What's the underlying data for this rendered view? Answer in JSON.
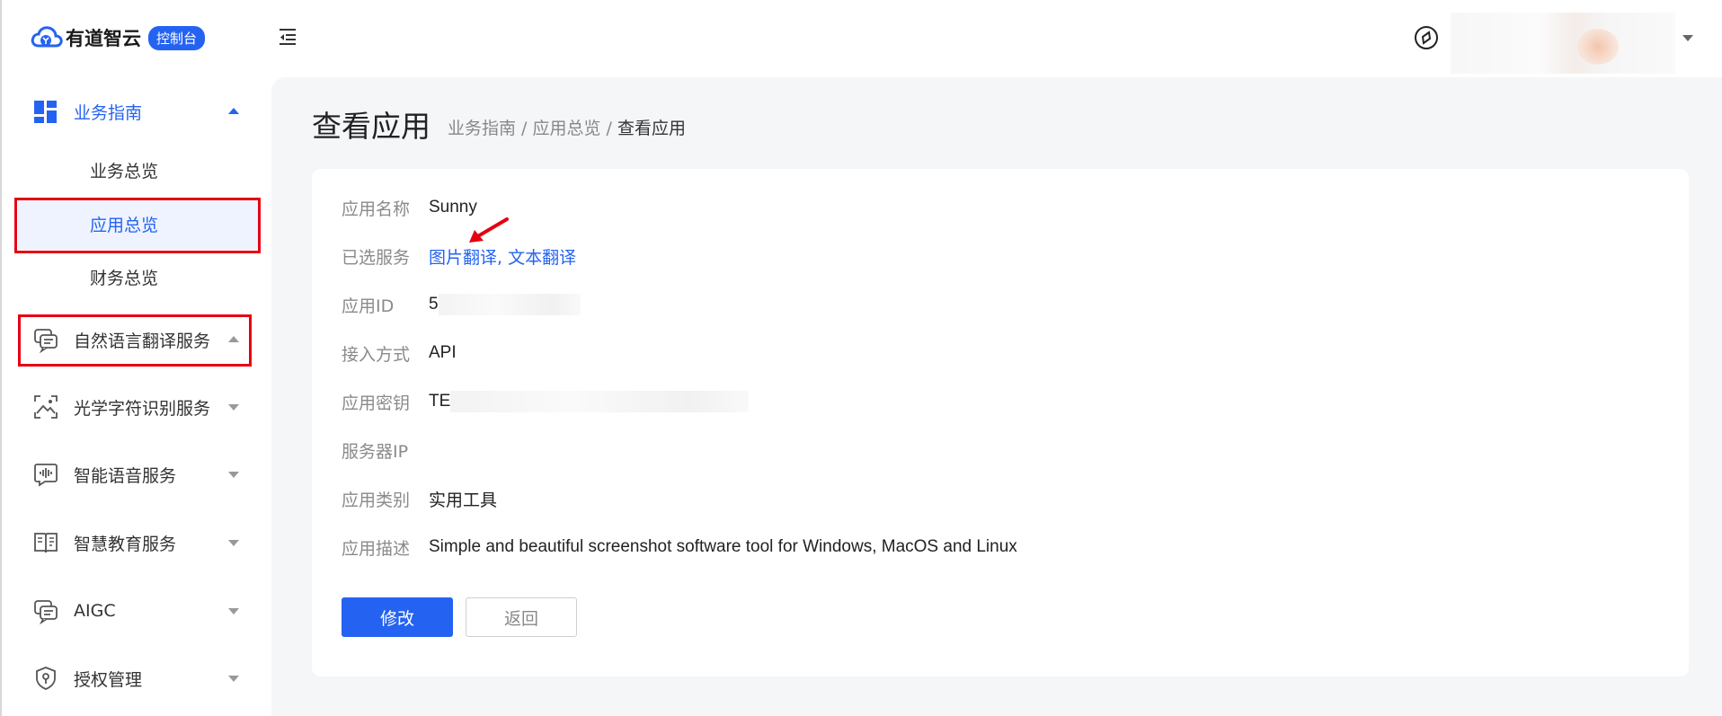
{
  "brand": {
    "name": "有道智云",
    "badge": "控制台",
    "accent_color": "#2463f2"
  },
  "sidebar": {
    "groups": [
      {
        "label": "业务指南",
        "icon": "dashboard-grid-icon",
        "expanded": true,
        "items": [
          {
            "label": "业务总览"
          },
          {
            "label": "应用总览",
            "selected": true
          },
          {
            "label": "财务总览"
          }
        ]
      },
      {
        "label": "自然语言翻译服务",
        "icon": "chat-translate-icon",
        "expanded": true
      },
      {
        "label": "光学字符识别服务",
        "icon": "scan-image-icon",
        "expanded": false
      },
      {
        "label": "智能语音服务",
        "icon": "voice-wave-icon",
        "expanded": false
      },
      {
        "label": "智慧教育服务",
        "icon": "education-book-icon",
        "expanded": false
      },
      {
        "label": "AIGC",
        "icon": "aigc-chat-icon",
        "expanded": false
      },
      {
        "label": "授权管理",
        "icon": "shield-key-icon",
        "expanded": false
      }
    ]
  },
  "page": {
    "title": "查看应用",
    "breadcrumb": {
      "parts": [
        "业务指南",
        "应用总览"
      ],
      "separator": " / ",
      "current": "查看应用"
    }
  },
  "details": {
    "name": {
      "label": "应用名称",
      "value": "Sunny"
    },
    "services": {
      "label": "已选服务",
      "value": "图片翻译, 文本翻译"
    },
    "app_id": {
      "label": "应用ID",
      "value": "5"
    },
    "access": {
      "label": "接入方式",
      "value": "API"
    },
    "secret": {
      "label": "应用密钥",
      "value": "TE"
    },
    "server_ip": {
      "label": "服务器IP",
      "value": ""
    },
    "category": {
      "label": "应用类别",
      "value": "实用工具"
    },
    "description": {
      "label": "应用描述",
      "value": "Simple and beautiful screenshot software tool for Windows, MacOS and Linux"
    }
  },
  "actions": {
    "edit": "修改",
    "back": "返回"
  }
}
